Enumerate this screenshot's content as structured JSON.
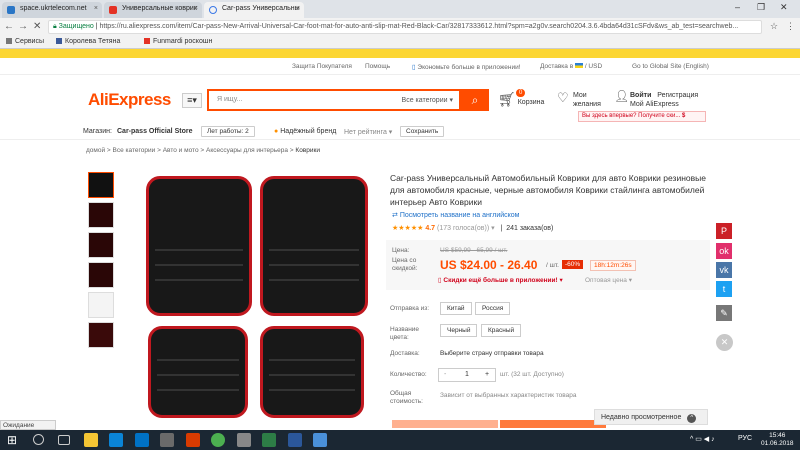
{
  "browser": {
    "tabs": [
      {
        "label": "space.ukrtelecom.net"
      },
      {
        "label": "Универсальные коврик"
      },
      {
        "label": "Car-pass Универсальны"
      }
    ],
    "secure_label": "Защищено",
    "url": "https://ru.aliexpress.com/item/Car-pass-New-Arrival-Universal-Car-foot-mat-for-auto-anti-slip-mat-Red-Black-Car/32817333612.html?spm=a2g0v.search0204.3.6.4bda64d31cSFdv&ws_ab_test=searchweb...",
    "bookmarks": [
      {
        "label": "Сервисы"
      },
      {
        "label": "Королева Тетяна"
      },
      {
        "label": "Funmardi роскошн"
      }
    ],
    "status_text": "Ожидание кеша...."
  },
  "site": {
    "top_nav": [
      "Защита Покупателя",
      "Помощь",
      "Экономьте больше в приложении!",
      "Доставка в",
      "/ USD",
      "Go to Global Site (English)"
    ],
    "logo": "AliExpress",
    "search_placeholder": "Я ищу...",
    "search_category": "Все категории",
    "cart_label": "Корзина",
    "cart_count": "0",
    "wishlist_line1": "Мои",
    "wishlist_line2": "желания",
    "login": "Войти",
    "register": "Регистрация",
    "my_account": "Мой AliExpress",
    "promo": "Вы здесь впервые? Получите ски...",
    "promo_icon": "$"
  },
  "store": {
    "store_label": "Магазин:",
    "store_name": "Car-pass Official Store",
    "years": "Лет работы: 2",
    "reliable": "Надёжный бренд",
    "no_rating": "Нет рейтинга",
    "save": "Сохранить"
  },
  "breadcrumb": [
    "домой",
    "Все категории",
    "Авто и мото",
    "Аксессуары для интерьера",
    "Коврики"
  ],
  "product": {
    "title": "Car-pass Универсальный Автомобильный Коврики для авто Коврики резиновые для автомобиля красные, черные автомобиля Коврики стайлинга автомобилей интерьер Авто Коврики",
    "english_link": "Посмотреть название на английском",
    "rating": "4.7",
    "votes": "(173 голоса(ов))",
    "orders": "241 заказа(ов)",
    "price_label": "Цена:",
    "old_price": "US $59,99 - 65,99 / шт.",
    "discount_label_1": "Цена со",
    "discount_label_2": "скидкой:",
    "price": "US $24.00 - 26.40",
    "unit": "/ шт.",
    "off": "-60%",
    "timer": "18h:12m:26s",
    "app_discount": "Скидки ещё больше в приложении!",
    "wholesale": "Оптовая цена",
    "ship_from_label": "Отправка из:",
    "ship_from": [
      "Китай",
      "Россия"
    ],
    "color_label_1": "Название",
    "color_label_2": "цвета:",
    "colors": [
      "Черный",
      "Красный"
    ],
    "delivery_label": "Доставка:",
    "delivery_value": "Выберите страну отправки товара",
    "qty_label": "Количество:",
    "qty_minus": "-",
    "qty_value": "1",
    "qty_plus": "+",
    "qty_note": "шт. (32 шт. Доступно)",
    "total_label_1": "Общая",
    "total_label_2": "стоимость:",
    "total_value": "Зависит от выбранных характеристик товара"
  },
  "recently_viewed": "Недавно просмотренное",
  "taskbar": {
    "lang": "РУС",
    "time": "15:46",
    "date": "01.06.2018"
  }
}
